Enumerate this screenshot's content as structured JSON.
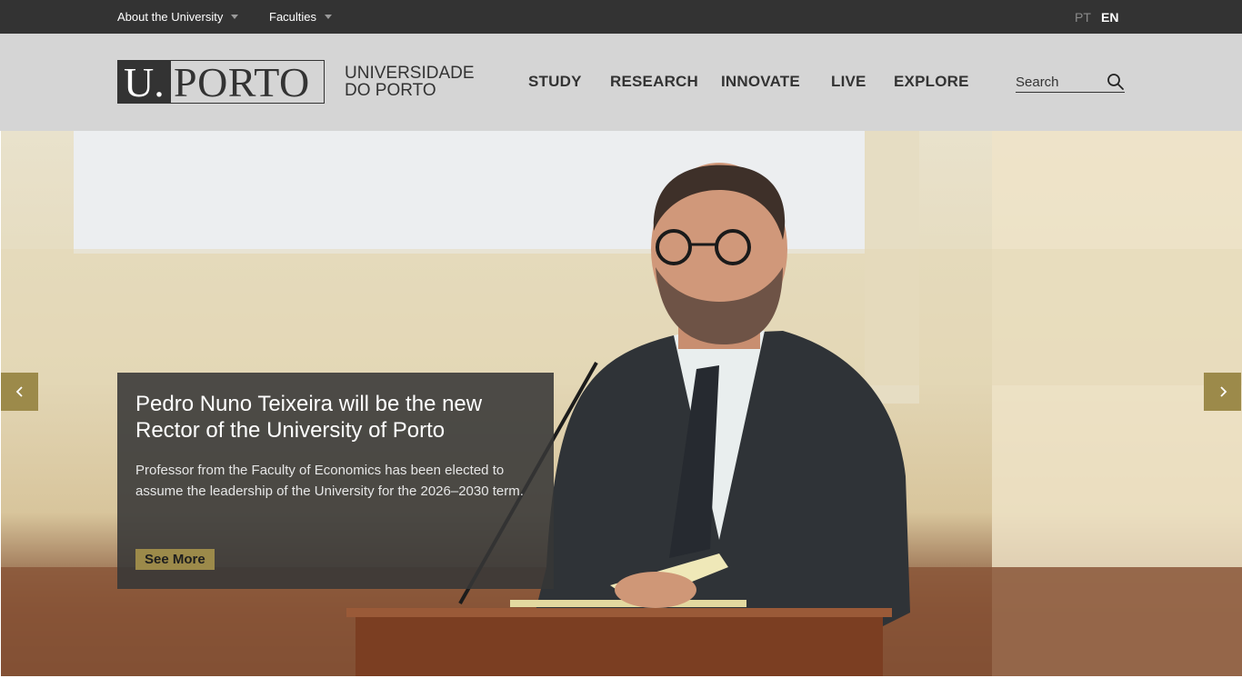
{
  "topbar": {
    "about": "About the University",
    "faculties": "Faculties",
    "lang_pt": "PT",
    "lang_en": "EN"
  },
  "header": {
    "logo_u": "U.",
    "logo_porto": "PORTO",
    "logo_sub_line1": "UNIVERSIDADE",
    "logo_sub_line2": "DO PORTO",
    "nav": [
      "STUDY",
      "RESEARCH",
      "INNOVATE",
      "LIVE",
      "EXPLORE"
    ],
    "search_placeholder": "Search"
  },
  "hero": {
    "title": "Pedro Nuno Teixeira will be the new Rector of the University of Porto",
    "description": "Professor from the Faculty of Economics has been elected to assume the leadership of the University for the 2026–2030 term.",
    "button": "See More"
  },
  "colors": {
    "topbar_bg": "#333333",
    "header_bg": "#d5d5d5",
    "accent_gold": "#9c8a4a",
    "caption_bg": "#373737"
  },
  "icons": [
    "caret-down-icon",
    "search-icon",
    "chevron-left-icon",
    "chevron-right-icon"
  ]
}
